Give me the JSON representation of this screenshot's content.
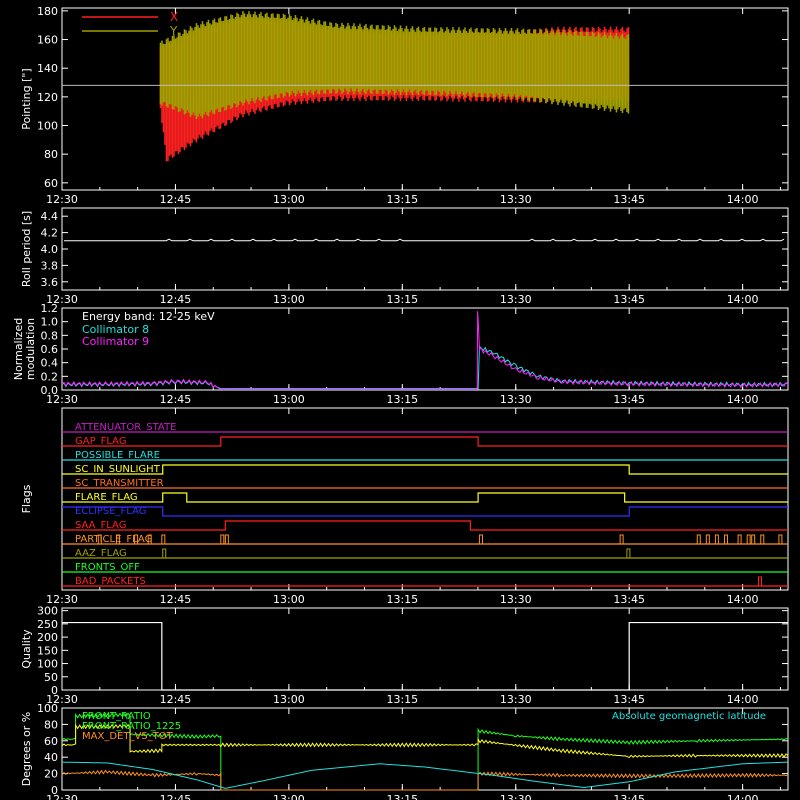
{
  "x_ticks": [
    "12:30",
    "12:45",
    "13:00",
    "13:15",
    "13:30",
    "13:45",
    "14:00"
  ],
  "colors": {
    "red": "#ff2020",
    "olive": "#a0a000",
    "white": "#ffffff",
    "cyan": "#20e0e0",
    "magenta": "#ff20ff",
    "green": "#20ff20",
    "yellow": "#ffff20",
    "orange": "#ff9020",
    "blue": "#3030ff",
    "purple": "#c020c0",
    "dkorange": "#ff7020"
  },
  "chart_data": [
    {
      "type": "line",
      "ylabel": "Pointing [\"]",
      "ylim": [
        55,
        182
      ],
      "yticks": [
        "60",
        "80",
        "100",
        "120",
        "140",
        "160",
        "180"
      ],
      "legend": [
        {
          "name": "X",
          "color": "#ff2020"
        },
        {
          "name": "Y",
          "color": "#a0a000"
        }
      ],
      "baseline": 128,
      "data_range_time": [
        "12:43",
        "13:45"
      ],
      "series": [
        {
          "name": "X",
          "color": "#ff2020",
          "upper": [
            [
              12.717,
              152
            ],
            [
              12.8,
              165
            ],
            [
              12.9,
              173
            ],
            [
              13.0,
              171
            ],
            [
              13.1,
              165
            ],
            [
              13.3,
              162
            ],
            [
              13.5,
              163
            ],
            [
              13.6,
              165
            ],
            [
              13.75,
              165
            ]
          ],
          "lower": [
            [
              12.717,
              115
            ],
            [
              12.73,
              78
            ],
            [
              12.8,
              93
            ],
            [
              12.9,
              110
            ],
            [
              13.0,
              118
            ],
            [
              13.1,
              121
            ],
            [
              13.3,
              121
            ],
            [
              13.5,
              120
            ],
            [
              13.6,
              119
            ],
            [
              13.75,
              120
            ]
          ]
        },
        {
          "name": "Y",
          "color": "#a0a000",
          "upper": [
            [
              12.717,
              155
            ],
            [
              12.8,
              168
            ],
            [
              12.9,
              176
            ],
            [
              13.0,
              174
            ],
            [
              13.1,
              168
            ],
            [
              13.3,
              165
            ],
            [
              13.5,
              164
            ],
            [
              13.6,
              163
            ],
            [
              13.75,
              160
            ]
          ],
          "lower": [
            [
              12.717,
              118
            ],
            [
              12.8,
              108
            ],
            [
              12.9,
              118
            ],
            [
              13.0,
              124
            ],
            [
              13.1,
              126
            ],
            [
              13.3,
              125
            ],
            [
              13.5,
              122
            ],
            [
              13.6,
              118
            ],
            [
              13.75,
              112
            ]
          ]
        }
      ]
    },
    {
      "type": "line",
      "ylabel": "Roll period [s]",
      "ylim": [
        3.5,
        4.5
      ],
      "yticks": [
        "3.6",
        "3.8",
        "4.0",
        "4.2",
        "4.4"
      ],
      "series": [
        {
          "name": "",
          "color": "#ffffff",
          "value": 4.1
        }
      ]
    },
    {
      "type": "line",
      "ylabel": [
        "Normalized",
        "modulation"
      ],
      "ylim": [
        0,
        1.2
      ],
      "yticks": [
        "0.0",
        "0.2",
        "0.4",
        "0.6",
        "0.8",
        "1.0",
        "1.2"
      ],
      "legend_title": "Energy band: 12-25 keV",
      "legend": [
        {
          "name": "Collimator 8",
          "color": "#20e0e0"
        },
        {
          "name": "Collimator 9",
          "color": "#ff20ff"
        }
      ],
      "series": [
        {
          "name": "Collimator 8",
          "color": "#20e0e0",
          "points": [
            [
              12.5,
              0.08
            ],
            [
              12.6,
              0.08
            ],
            [
              12.7,
              0.09
            ],
            [
              12.75,
              0.12
            ],
            [
              12.82,
              0.1
            ],
            [
              12.85,
              0.02
            ],
            [
              13.417,
              0.02
            ],
            [
              13.42,
              0.62
            ],
            [
              13.45,
              0.55
            ],
            [
              13.5,
              0.35
            ],
            [
              13.55,
              0.2
            ],
            [
              13.6,
              0.13
            ],
            [
              13.75,
              0.1
            ],
            [
              14.0,
              0.08
            ],
            [
              14.1,
              0.08
            ]
          ]
        },
        {
          "name": "Collimator 9",
          "color": "#ff20ff",
          "points": [
            [
              12.5,
              0.09
            ],
            [
              12.6,
              0.09
            ],
            [
              12.7,
              0.1
            ],
            [
              12.75,
              0.13
            ],
            [
              12.82,
              0.11
            ],
            [
              12.85,
              0.01
            ],
            [
              13.415,
              0.01
            ],
            [
              13.416,
              1.18
            ],
            [
              13.42,
              0.6
            ],
            [
              13.45,
              0.5
            ],
            [
              13.5,
              0.3
            ],
            [
              13.55,
              0.18
            ],
            [
              13.6,
              0.12
            ],
            [
              13.75,
              0.09
            ],
            [
              14.0,
              0.07
            ],
            [
              14.1,
              0.08
            ]
          ]
        }
      ]
    },
    {
      "type": "step",
      "ylabel": "Flags",
      "flags": [
        {
          "name": "ATTENUATOR_STATE",
          "color": "#c020c0",
          "segments": [
            [
              12.5,
              14.1,
              0
            ]
          ]
        },
        {
          "name": "GAP_FLAG",
          "color": "#ff2020",
          "segments": [
            [
              12.5,
              12.85,
              0
            ],
            [
              12.85,
              13.417,
              1
            ],
            [
              13.417,
              14.1,
              0
            ]
          ]
        },
        {
          "name": "POSSIBLE_FLARE",
          "color": "#20e0e0",
          "segments": [
            [
              12.5,
              14.1,
              0
            ]
          ]
        },
        {
          "name": "SC_IN_SUNLIGHT",
          "color": "#ffff20",
          "segments": [
            [
              12.5,
              12.722,
              0
            ],
            [
              12.722,
              13.75,
              1
            ],
            [
              13.75,
              14.1,
              0
            ]
          ]
        },
        {
          "name": "SC_TRANSMITTER",
          "color": "#ff7020",
          "segments": [
            [
              12.5,
              14.1,
              0
            ]
          ]
        },
        {
          "name": "FLARE_FLAG",
          "color": "#ffff20",
          "segments": [
            [
              12.5,
              12.722,
              0
            ],
            [
              12.722,
              12.775,
              1
            ],
            [
              12.775,
              13.417,
              0
            ],
            [
              13.417,
              13.74,
              1
            ],
            [
              13.74,
              14.1,
              0
            ]
          ]
        },
        {
          "name": "ECLIPSE_FLAG",
          "color": "#3030ff",
          "segments": [
            [
              12.5,
              12.722,
              1
            ],
            [
              12.722,
              13.75,
              0
            ],
            [
              13.75,
              14.1,
              1
            ]
          ]
        },
        {
          "name": "SAA_FLAG",
          "color": "#ff2020",
          "segments": [
            [
              12.5,
              12.86,
              0
            ],
            [
              12.86,
              13.4,
              1
            ],
            [
              13.4,
              14.1,
              0
            ]
          ]
        },
        {
          "name": "PARTICLE_FLAG",
          "color": "#ff9020",
          "segments": [
            [
              12.5,
              14.1,
              0
            ]
          ],
          "pulses": [
            12.58,
            12.62,
            12.66,
            12.69,
            12.72,
            12.85,
            12.86,
            13.42,
            13.73,
            13.9,
            13.92,
            13.94,
            13.96,
            13.99,
            14.01,
            14.02,
            14.04,
            14.08
          ]
        },
        {
          "name": "AAZ_FLAG",
          "color": "#a0a000",
          "segments": [
            [
              12.5,
              14.1,
              0
            ]
          ],
          "pulses": [
            12.722,
            13.745
          ]
        },
        {
          "name": "FRONTS_OFF",
          "color": "#20ff20",
          "segments": [
            [
              12.5,
              14.1,
              0
            ]
          ]
        },
        {
          "name": "BAD_PACKETS",
          "color": "#ff2020",
          "segments": [
            [
              12.5,
              14.1,
              0
            ]
          ],
          "pulses": [
            14.035
          ]
        }
      ]
    },
    {
      "type": "step",
      "ylabel": "Quality",
      "ylim": [
        0,
        310
      ],
      "yticks": [
        "0",
        "50",
        "100",
        "150",
        "200",
        "250",
        "300"
      ],
      "series": [
        {
          "name": "",
          "color": "#ffffff",
          "points": [
            [
              12.5,
              255
            ],
            [
              12.72,
              255
            ],
            [
              12.72,
              0
            ],
            [
              13.75,
              0
            ],
            [
              13.75,
              255
            ],
            [
              14.1,
              255
            ]
          ]
        }
      ]
    },
    {
      "type": "line",
      "ylabel": "Degrees or %",
      "ylim": [
        0,
        100
      ],
      "yticks": [
        "0",
        "20",
        "40",
        "60",
        "80",
        "100"
      ],
      "legend": [
        {
          "name": "FRONT_RATIO",
          "color": "#20ff20"
        },
        {
          "name": "FRONT_RATIO_1225",
          "color": "#20ff20"
        },
        {
          "name": "MAX_DET_VS_TOT",
          "color": "#ff9020"
        }
      ],
      "legend_right": {
        "name": "Absolute geomagnetic latitude",
        "color": "#20e0e0"
      },
      "series": [
        {
          "name": "FRONT_RATIO",
          "color": "#20ff20",
          "points": [
            [
              12.5,
              62
            ],
            [
              12.53,
              62
            ],
            [
              12.53,
              90
            ],
            [
              12.65,
              92
            ],
            [
              12.65,
              68
            ],
            [
              12.8,
              65
            ],
            [
              12.85,
              66
            ],
            [
              12.85,
              0
            ],
            [
              13.417,
              0
            ],
            [
              13.417,
              72
            ],
            [
              13.5,
              66
            ],
            [
              13.6,
              62
            ],
            [
              13.75,
              58
            ],
            [
              13.9,
              60
            ],
            [
              14.1,
              62
            ]
          ]
        },
        {
          "name": "MAX_DET_VS_TOT",
          "color": "#ff9020",
          "points": [
            [
              12.5,
              20
            ],
            [
              12.6,
              22
            ],
            [
              12.7,
              18
            ],
            [
              12.8,
              20
            ],
            [
              12.85,
              18
            ],
            [
              12.85,
              0
            ],
            [
              13.417,
              0
            ],
            [
              13.417,
              20
            ],
            [
              13.6,
              18
            ],
            [
              13.8,
              17
            ],
            [
              14.0,
              18
            ],
            [
              14.1,
              18
            ]
          ]
        },
        {
          "name": "FRONT_RATIO_1225",
          "color": "#ffff20",
          "points": [
            [
              12.5,
              55
            ],
            [
              12.53,
              55
            ],
            [
              12.53,
              77
            ],
            [
              12.65,
              78
            ],
            [
              12.65,
              47
            ],
            [
              12.72,
              48
            ],
            [
              12.72,
              55
            ],
            [
              12.85,
              55
            ],
            [
              13.417,
              55
            ],
            [
              13.417,
              60
            ],
            [
              13.6,
              48
            ],
            [
              13.75,
              41
            ],
            [
              13.9,
              42
            ],
            [
              14.1,
              42
            ]
          ]
        },
        {
          "name": "Absolute geomagnetic latitude",
          "color": "#20e0e0",
          "points": [
            [
              12.5,
              34
            ],
            [
              12.6,
              33
            ],
            [
              12.7,
              25
            ],
            [
              12.8,
              12
            ],
            [
              12.86,
              2
            ],
            [
              12.95,
              12
            ],
            [
              13.05,
              24
            ],
            [
              13.2,
              32
            ],
            [
              13.3,
              28
            ],
            [
              13.45,
              18
            ],
            [
              13.55,
              10
            ],
            [
              13.65,
              3
            ],
            [
              13.75,
              10
            ],
            [
              13.85,
              22
            ],
            [
              14.0,
              32
            ],
            [
              14.1,
              34
            ]
          ]
        }
      ]
    }
  ]
}
